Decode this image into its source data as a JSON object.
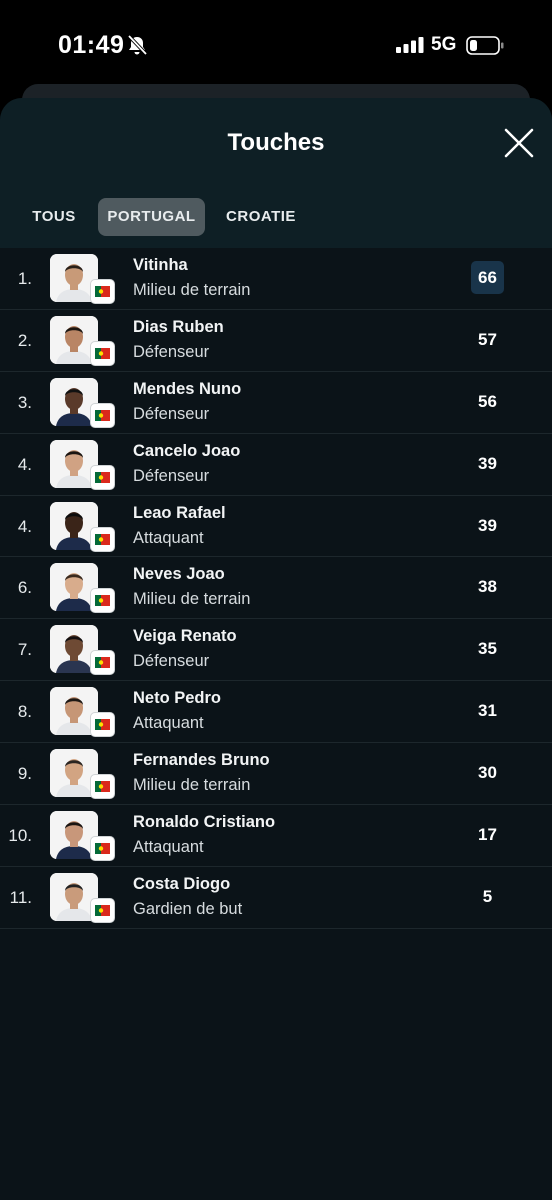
{
  "status": {
    "time": "01:49",
    "network": "5G"
  },
  "sheet": {
    "title": "Touches"
  },
  "tabs": [
    {
      "label": "TOUS",
      "active": false
    },
    {
      "label": "PORTUGAL",
      "active": true
    },
    {
      "label": "CROATIE",
      "active": false
    }
  ],
  "colors": {
    "background": "#0b1318",
    "header": "#0e1f25",
    "active_tab": "#4f5a5f",
    "highlight": "#19344a",
    "flag_green": "#046a38",
    "flag_red": "#da291c"
  },
  "players": [
    {
      "rank": "1.",
      "name": "Vitinha",
      "position": "Milieu de terrain",
      "value": "66",
      "highlight": true
    },
    {
      "rank": "2.",
      "name": "Dias Ruben",
      "position": "Défenseur",
      "value": "57"
    },
    {
      "rank": "3.",
      "name": "Mendes Nuno",
      "position": "Défenseur",
      "value": "56"
    },
    {
      "rank": "4.",
      "name": "Cancelo Joao",
      "position": "Défenseur",
      "value": "39"
    },
    {
      "rank": "4.",
      "name": "Leao Rafael",
      "position": "Attaquant",
      "value": "39"
    },
    {
      "rank": "6.",
      "name": "Neves Joao",
      "position": "Milieu de terrain",
      "value": "38"
    },
    {
      "rank": "7.",
      "name": "Veiga Renato",
      "position": "Défenseur",
      "value": "35"
    },
    {
      "rank": "8.",
      "name": "Neto Pedro",
      "position": "Attaquant",
      "value": "31"
    },
    {
      "rank": "9.",
      "name": "Fernandes Bruno",
      "position": "Milieu de terrain",
      "value": "30"
    },
    {
      "rank": "10.",
      "name": "Ronaldo Cristiano",
      "position": "Attaquant",
      "value": "17"
    },
    {
      "rank": "11.",
      "name": "Costa Diogo",
      "position": "Gardien de but",
      "value": "5"
    }
  ]
}
